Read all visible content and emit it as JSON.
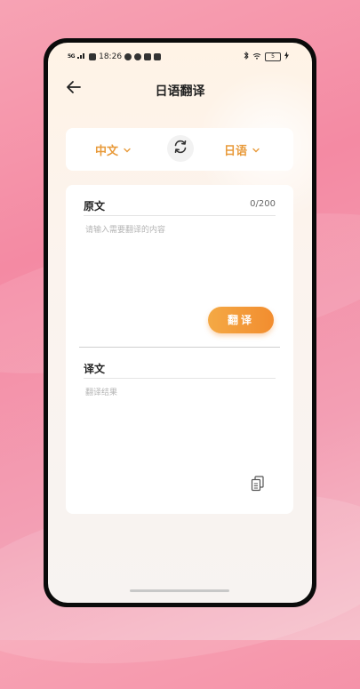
{
  "status_bar": {
    "network": "5G",
    "time": "18:26",
    "battery": "5"
  },
  "header": {
    "title": "日语翻译"
  },
  "language_selector": {
    "source_language": "中文",
    "target_language": "日语"
  },
  "source_section": {
    "label": "原文",
    "counter": "0/200",
    "placeholder": "请输入需要翻译的内容"
  },
  "translate_button": {
    "label": "翻译"
  },
  "result_section": {
    "label": "译文",
    "placeholder": "翻译结果"
  },
  "colors": {
    "accent": "#f29a3a",
    "text": "#222222",
    "placeholder": "#b5b5b5"
  },
  "icons": {
    "back": "arrow-left-icon",
    "swap": "swap-icon",
    "copy": "copy-icon"
  }
}
